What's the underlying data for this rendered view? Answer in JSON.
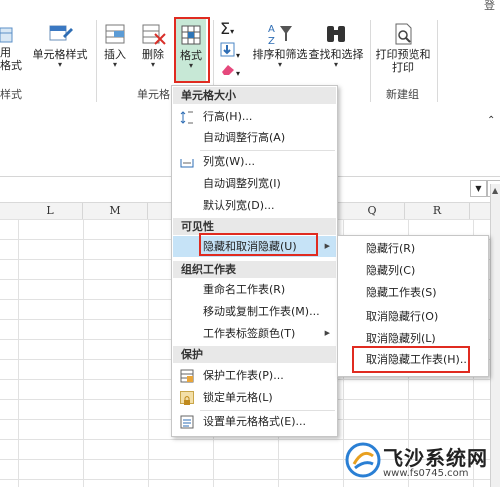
{
  "corner": {
    "text": "登"
  },
  "ribbon": {
    "buttons": {
      "cell_style_partial": "用\n格式",
      "cell_styles": "单元格样式",
      "insert": "插入",
      "delete": "删除",
      "format": "格式",
      "sort_filter": "排序和筛选",
      "find_select": "查找和选择",
      "print_preview": "打印预览和\n打印"
    },
    "groups": {
      "styles_partial": "样式",
      "cells_partial": "单元格",
      "new_group": "新建组"
    }
  },
  "sheet": {
    "columns": [
      "L",
      "M",
      "Q",
      "R"
    ]
  },
  "format_menu": {
    "sections": {
      "cell_size": "单元格大小",
      "visibility": "可见性",
      "organize": "组织工作表",
      "protection": "保护"
    },
    "items": {
      "row_height": "行高(H)...",
      "autofit_row": "自动调整行高(A)",
      "col_width": "列宽(W)...",
      "autofit_col": "自动调整列宽(I)",
      "default_width": "默认列宽(D)...",
      "hide_unhide": "隐藏和取消隐藏(U)",
      "rename_sheet": "重命名工作表(R)",
      "move_copy": "移动或复制工作表(M)...",
      "tab_color": "工作表标签颜色(T)",
      "protect_sheet": "保护工作表(P)...",
      "lock_cell": "锁定单元格(L)",
      "format_cells": "设置单元格格式(E)..."
    }
  },
  "hide_submenu": {
    "items": [
      "隐藏行(R)",
      "隐藏列(C)",
      "隐藏工作表(S)",
      "取消隐藏行(O)",
      "取消隐藏列(L)",
      "取消隐藏工作表(H)..."
    ]
  },
  "watermark": {
    "brand": "飞沙系统网",
    "url": "www.fs0745.com"
  },
  "colors": {
    "highlight_red": "#e02b20",
    "menu_hover": "#c6e3f7",
    "format_btn_bg": "#c7e8d6",
    "section_bg": "#e8e8e8"
  }
}
